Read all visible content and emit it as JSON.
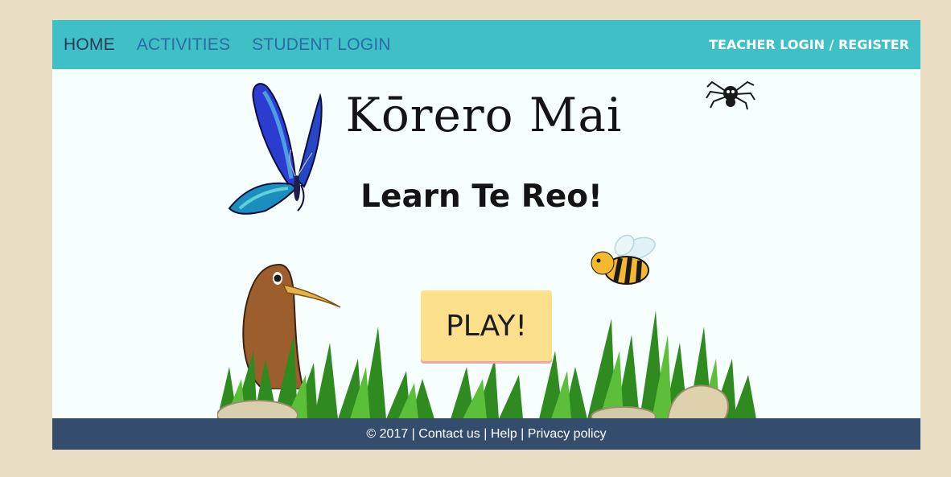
{
  "nav": {
    "home": "HOME",
    "activities": "ACTIVITIES",
    "student_login": "STUDENT LOGIN",
    "teacher_login": "TEACHER LOGIN / REGISTER"
  },
  "hero": {
    "title": "Kōrero Mai",
    "subtitle": "Learn Te Reo!",
    "play_label": "PLAY!"
  },
  "footer": {
    "copyright": "© 2017",
    "sep": " | ",
    "contact": "Contact us",
    "help": "Help",
    "privacy": "Privacy policy"
  },
  "colors": {
    "navbar": "#3fc0c7",
    "nav_link": "#2e6aa8",
    "nav_active": "#2b3a55",
    "play_button": "#fde08c",
    "footer": "#344d6c",
    "page_bg": "#e8dcc2"
  },
  "icons": [
    "butterfly-illustration",
    "spider-illustration",
    "bee-illustration",
    "kiwi-illustration",
    "grass-illustration",
    "rock-illustration"
  ]
}
